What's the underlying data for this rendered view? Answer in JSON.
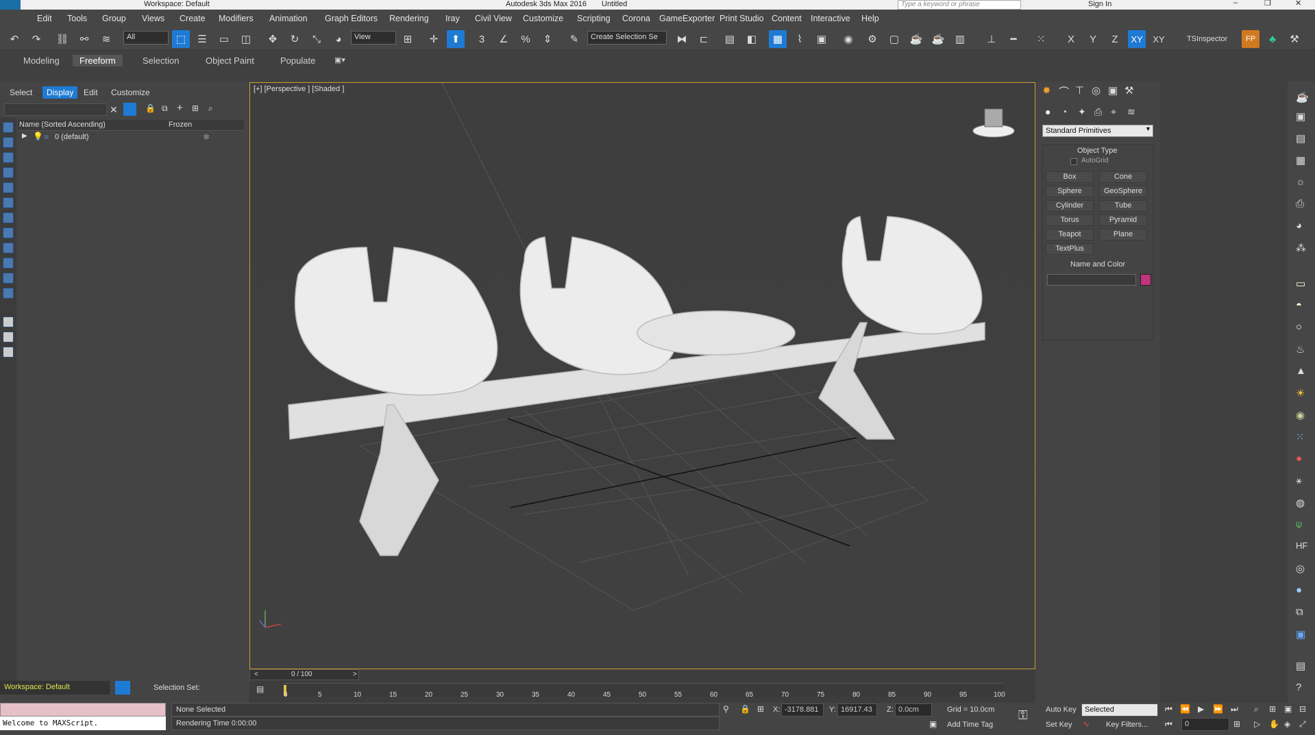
{
  "titlebar": {
    "title": "Autodesk 3ds Max 2016",
    "doc": "Untitled",
    "workspace": "Workspace: Default",
    "search_placeholder": "Type a keyword or phrase",
    "sign_in": "Sign In"
  },
  "menu": [
    "Edit",
    "Tools",
    "Group",
    "Views",
    "Create",
    "Modifiers",
    "Animation",
    "Graph Editors",
    "Rendering",
    "Iray",
    "Civil View",
    "Customize",
    "Scripting",
    "Corona",
    "GameExporter",
    "Print Studio",
    "Content",
    "Interactive",
    "Help"
  ],
  "toolbar": {
    "filter": "All",
    "refcoord": "View",
    "selection_set": "Create Selection Se",
    "axes": [
      "X",
      "Y",
      "Z",
      "XY",
      "XY"
    ],
    "tsinspector": "TSInspector"
  },
  "ribbon": {
    "tabs": [
      "Modeling",
      "Freeform",
      "Selection",
      "Object Paint",
      "Populate"
    ],
    "active": "Freeform"
  },
  "scene": {
    "tabs": [
      "Select",
      "Display",
      "Edit",
      "Customize"
    ],
    "active": "Display",
    "col_name": "Name (Sorted Ascending)",
    "col_frozen": "Frozen",
    "layer": "0 (default)"
  },
  "viewport": {
    "label": "[+] [Perspective ] [Shaded ]"
  },
  "command": {
    "category": "Standard Primitives",
    "object_type": "Object Type",
    "autogrid": "AutoGrid",
    "buttons": [
      "Box",
      "Cone",
      "Sphere",
      "GeoSphere",
      "Cylinder",
      "Tube",
      "Torus",
      "Pyramid",
      "Teapot",
      "Plane",
      "TextPlus"
    ],
    "name_color": "Name and Color",
    "color": "#c0347a"
  },
  "timeline": {
    "frame": "0 / 100",
    "ticks": [
      "0",
      "5",
      "10",
      "15",
      "20",
      "25",
      "30",
      "35",
      "40",
      "45",
      "50",
      "55",
      "60",
      "65",
      "70",
      "75",
      "80",
      "85",
      "90",
      "95",
      "100"
    ]
  },
  "status": {
    "workspace": "Workspace: Default",
    "selection_set": "Selection Set:",
    "maxscript": "Welcome to MAXScript.",
    "none_selected": "None Selected",
    "rendering_time": "Rendering Time  0:00:00",
    "x": "-3178.881",
    "y": "16917.43",
    "z": "0.0cm",
    "grid": "Grid = 10.0cm",
    "add_time_tag": "Add Time Tag",
    "auto_key": "Auto Key",
    "selected": "Selected",
    "set_key": "Set Key",
    "key_filters": "Key Filters...",
    "frame_field": "0"
  },
  "colors": {
    "accent": "#1e7bd4",
    "viewport_border": "#c8a030"
  }
}
